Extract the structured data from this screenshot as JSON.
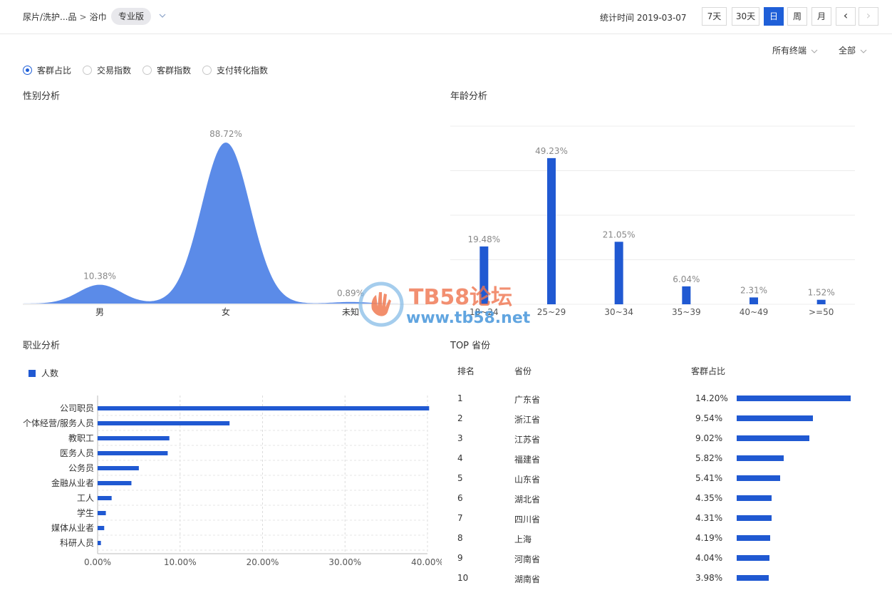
{
  "header": {
    "breadcrumb_1": "尿片/洗护...品",
    "breadcrumb_sep": ">",
    "breadcrumb_2": "浴巾",
    "edition": "专业版",
    "stat_time": "统计时间 2019-03-07",
    "ranges": [
      "7天",
      "30天",
      "日",
      "周",
      "月"
    ],
    "active_range": "日",
    "prev": "‹",
    "next": "›"
  },
  "filters": {
    "terminal": "所有终端",
    "scope": "全部"
  },
  "tabs": [
    {
      "label": "客群占比",
      "selected": true
    },
    {
      "label": "交易指数",
      "selected": false
    },
    {
      "label": "客群指数",
      "selected": false
    },
    {
      "label": "支付转化指数",
      "selected": false
    }
  ],
  "sections": {
    "gender": "性别分析",
    "age": "年龄分析",
    "job": "职业分析",
    "province": "TOP 省份"
  },
  "watermark": {
    "brand": "TB58论坛",
    "url": "www.tb58.net"
  },
  "province_table": {
    "headers": [
      "排名",
      "省份",
      "客群占比"
    ],
    "rows": [
      {
        "rank": "1",
        "name": "广东省",
        "pct": "14.20%",
        "value": 14.2
      },
      {
        "rank": "2",
        "name": "浙江省",
        "pct": "9.54%",
        "value": 9.54
      },
      {
        "rank": "3",
        "name": "江苏省",
        "pct": "9.02%",
        "value": 9.02
      },
      {
        "rank": "4",
        "name": "福建省",
        "pct": "5.82%",
        "value": 5.82
      },
      {
        "rank": "5",
        "name": "山东省",
        "pct": "5.41%",
        "value": 5.41
      },
      {
        "rank": "6",
        "name": "湖北省",
        "pct": "4.35%",
        "value": 4.35
      },
      {
        "rank": "7",
        "name": "四川省",
        "pct": "4.31%",
        "value": 4.31
      },
      {
        "rank": "8",
        "name": "上海",
        "pct": "4.19%",
        "value": 4.19
      },
      {
        "rank": "9",
        "name": "河南省",
        "pct": "4.04%",
        "value": 4.04
      },
      {
        "rank": "10",
        "name": "湖南省",
        "pct": "3.98%",
        "value": 3.98
      }
    ]
  },
  "colors": {
    "accent": "#1f5fd8",
    "area": "#5b8be8",
    "bar": "#2059d2"
  },
  "chart_data": [
    {
      "type": "area",
      "categories": [
        "男",
        "女",
        "未知"
      ],
      "values": [
        10.38,
        88.72,
        0.89
      ],
      "labels": [
        "10.38%",
        "88.72%",
        "0.89%"
      ]
    },
    {
      "type": "bar",
      "categories": [
        "18~24",
        "25~29",
        "30~34",
        "35~39",
        "40~49",
        ">=50"
      ],
      "values": [
        19.48,
        49.23,
        21.05,
        6.04,
        2.31,
        1.52
      ],
      "labels": [
        "19.48%",
        "49.23%",
        "21.05%",
        "6.04%",
        "2.31%",
        "1.52%"
      ],
      "ylim": [
        0,
        60
      ],
      "grid": true
    },
    {
      "type": "bar",
      "orientation": "horizontal",
      "legend": "人数",
      "categories": [
        "公司职员",
        "个体经营/服务人员",
        "教职工",
        "医务人员",
        "公务员",
        "金融从业者",
        "工人",
        "学生",
        "媒体从业者",
        "科研人员"
      ],
      "values": [
        40.2,
        16.0,
        8.7,
        8.5,
        5.0,
        4.1,
        1.7,
        1.0,
        0.8,
        0.4
      ],
      "xlim": [
        0,
        40
      ],
      "ticks": [
        "0.00%",
        "10.00%",
        "20.00%",
        "30.00%",
        "40.00%"
      ],
      "grid": true
    }
  ]
}
